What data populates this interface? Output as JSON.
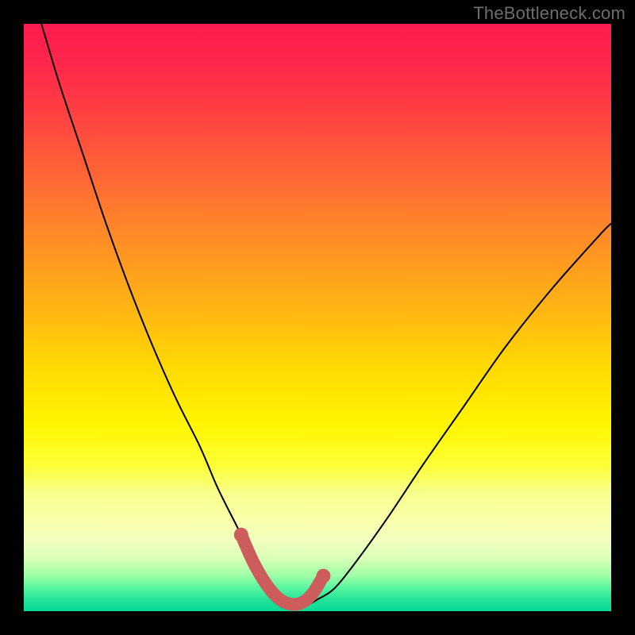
{
  "watermark": "TheBottleneck.com",
  "chart_data": {
    "type": "line",
    "title": "",
    "xlabel": "",
    "ylabel": "",
    "xlim": [
      0,
      100
    ],
    "ylim": [
      0,
      100
    ],
    "series": [
      {
        "name": "bottleneck-curve",
        "x": [
          3,
          6,
          10,
          14,
          18,
          22,
          26,
          30,
          33,
          36,
          38,
          40,
          42,
          44,
          46,
          48,
          50,
          53,
          57,
          62,
          68,
          75,
          82,
          90,
          98,
          100
        ],
        "values": [
          100,
          90,
          78,
          66,
          55,
          45,
          36,
          28,
          21,
          15,
          11,
          7,
          4,
          2,
          1,
          1,
          2,
          4,
          9,
          16,
          25,
          35,
          45,
          55,
          64,
          66
        ]
      },
      {
        "name": "highlight-segment",
        "x": [
          37,
          39,
          41,
          43,
          45,
          47,
          49,
          51
        ],
        "values": [
          13,
          8.5,
          5,
          2.5,
          1.3,
          1.3,
          2.8,
          6
        ]
      }
    ],
    "highlight_color": "#cd5c5c",
    "curve_color": "#000000"
  }
}
